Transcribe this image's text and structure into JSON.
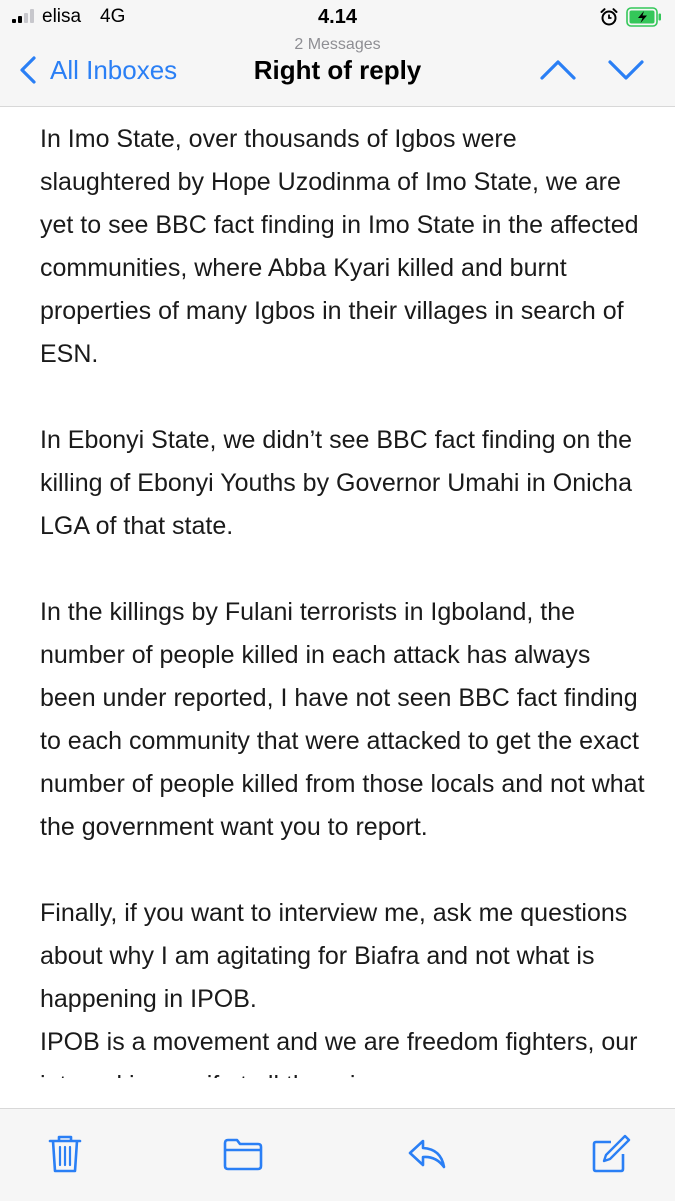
{
  "status_bar": {
    "carrier": "elisa",
    "network": "4G",
    "time": "4.14",
    "icons": [
      "signal-icon",
      "alarm-icon",
      "battery-charging-icon"
    ]
  },
  "nav": {
    "back_label": "All Inboxes",
    "message_count": "2 Messages",
    "title": "Right of reply",
    "icons": [
      "chevron-left-icon",
      "chevron-up-icon",
      "chevron-down-icon"
    ]
  },
  "body": {
    "paragraphs": [
      "In Imo State, over thousands of Igbos were slaughtered by Hope Uzodinma of Imo State, we are yet to see BBC fact finding in Imo State in the affected communities, where Abba Kyari killed and burnt properties of many Igbos in their villages in search of ESN.",
      "In Ebonyi State, we didn’t see BBC fact finding on the killing of Ebonyi Youths by Governor Umahi in Onicha LGA of that state.",
      "In the killings by Fulani terrorists in Igboland, the number of people killed in each attack has always been under reported, I have not seen BBC fact finding to each community that were attacked to get the exact number of people killed from those locals and not what the government want you to report.",
      "Finally, if you want to interview me, ask me questions about why I am agitating for Biafra and not what is happening in IPOB.",
      "IPOB is a movement and we are freedom fighters, our internal issues if at all there is any"
    ]
  },
  "toolbar": {
    "icons": [
      "trash-icon",
      "folder-icon",
      "reply-icon",
      "compose-icon"
    ]
  },
  "colors": {
    "accent": "#2a7ff5",
    "bar_background": "#f6f6f6",
    "battery_green": "#34c759"
  }
}
